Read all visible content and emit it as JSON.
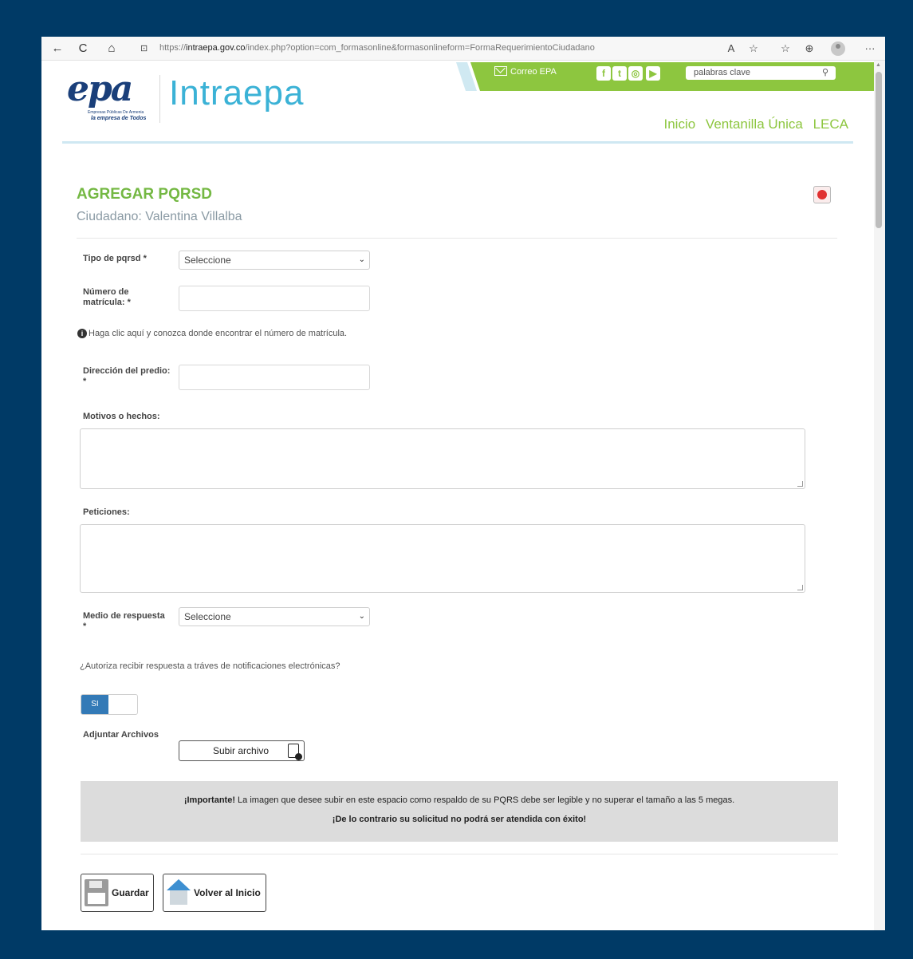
{
  "browser": {
    "back": "←",
    "refresh": "C",
    "home": "⌂",
    "lock": "🔒",
    "url_prefix": "https://",
    "url_host": "intraepa.gov.co",
    "url_path": "/index.php?option=com_formasonline&formasonlineform=FormaRequerimientoCiudadano",
    "read_aloud": "A",
    "menu": "···"
  },
  "header": {
    "logo_text": "epa",
    "logo_small": "Empresas Públicas De Armenia",
    "logo_tagline": "la empresa de Todos",
    "site_name": "Intraepa",
    "correo": "Correo EPA",
    "social": [
      "f",
      "t",
      "◎",
      "▶"
    ],
    "search_placeholder": "palabras clave",
    "nav": [
      "Inicio",
      "Ventanilla Única",
      "LECA"
    ]
  },
  "form": {
    "title": "AGREGAR PQRSD",
    "citizen": "Ciudadano: Valentina Villalba",
    "tipo_label": "Tipo de pqrsd *",
    "tipo_value": "Seleccione",
    "matricula_label_1": "Número de",
    "matricula_label_2": "matrícula: *",
    "info_text": "Haga clic aquí y conozca donde encontrar el número de matrícula.",
    "direccion_label_1": "Dirección del predio:",
    "direccion_label_2": "*",
    "motivos_label": "Motivos o hechos:",
    "peticiones_label": "Peticiones:",
    "medio_label_1": "Medio de respuesta",
    "medio_label_2": "*",
    "medio_value": "Seleccione",
    "autoriza_text": "¿Autoriza recibir respuesta a tráves de notificaciones electrónicas?",
    "toggle_label": "SI",
    "adjuntar_label": "Adjuntar Archivos",
    "upload_label": "Subir archivo"
  },
  "notice": {
    "important": "¡Importante!",
    "line1": " La imagen que desee subir en este espacio como respaldo de su PQRS debe ser legible y no superar el tamaño a las 5 megas.",
    "line2": "¡De lo contrario su solicitud no podrá ser atendida con éxito!"
  },
  "actions": {
    "guardar": "Guardar",
    "volver": "Volver al Inicio"
  }
}
